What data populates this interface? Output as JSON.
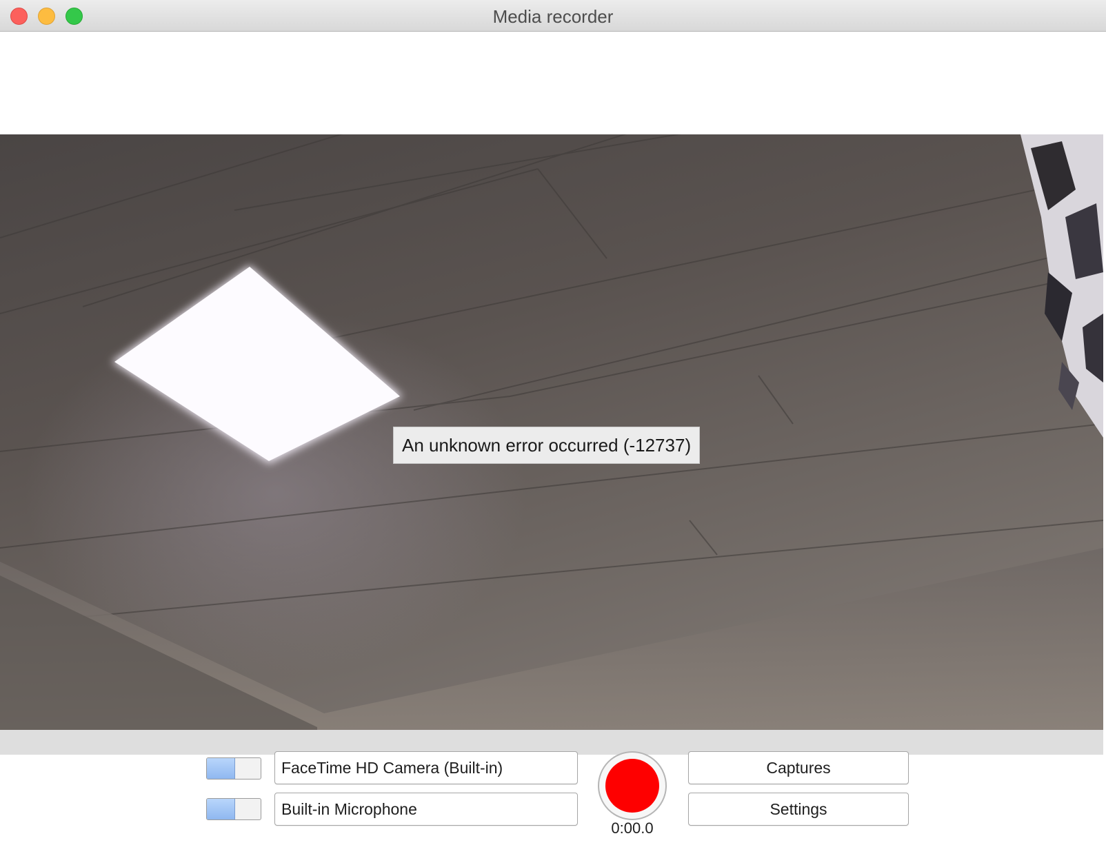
{
  "window": {
    "title": "Media recorder"
  },
  "preview": {
    "error_message": "An unknown error occurred (-12737)"
  },
  "controls": {
    "camera_toggle_on": true,
    "camera_device": "FaceTime HD Camera (Built-in)",
    "microphone_toggle_on": true,
    "microphone_device": "Built-in Microphone",
    "timer": "0:00.0",
    "captures_label": "Captures",
    "settings_label": "Settings"
  },
  "colors": {
    "record": "#fe0000",
    "toggle_on": "#9fc4f5"
  }
}
